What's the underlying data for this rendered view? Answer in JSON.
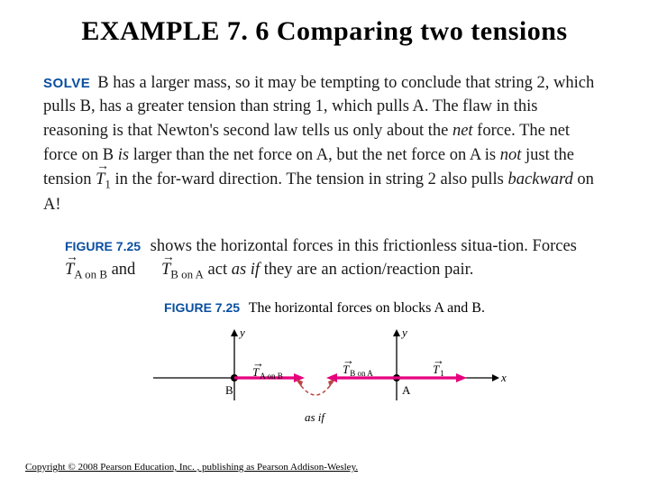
{
  "title": "EXAMPLE 7. 6 Comparing two tensions",
  "solve_label": "SOLVE",
  "para": {
    "p1a": "B has a larger mass, so it may be tempting to conclude that string 2, which pulls B, has a greater tension than string 1, which pulls A. The flaw in this reasoning is that Newton's second law tells us only about the ",
    "p1b": " force. The net force on B ",
    "p1c": " larger than the net force on A, but the net force on A is ",
    "p1d": " just the tension ",
    "p1e": " in the for-ward direction. The tension in string 2 also pulls ",
    "p1f": " on A!",
    "net": "net",
    "is": "is",
    "not": "not",
    "backward": "backward",
    "T1sub": "1"
  },
  "figure_label": "FIGURE 7.25",
  "para2": {
    "a": " shows the horizontal forces in this frictionless situa-tion. Forces ",
    "b": " and ",
    "c": " act ",
    "d": " they are an action/reaction pair.",
    "asif": "as if",
    "subAonB": "A on B",
    "subBonA": "B on A"
  },
  "caption": "The horizontal forces on blocks A and B.",
  "diagram": {
    "y": "y",
    "x": "x",
    "B": "B",
    "A": "A",
    "asif": "as if",
    "T": "T",
    "subAonB": "A on B",
    "subBonA": "B on A",
    "sub1": "1"
  },
  "copyright": "Copyright © 2008 Pearson Education, Inc. , publishing as Pearson Addison-Wesley."
}
